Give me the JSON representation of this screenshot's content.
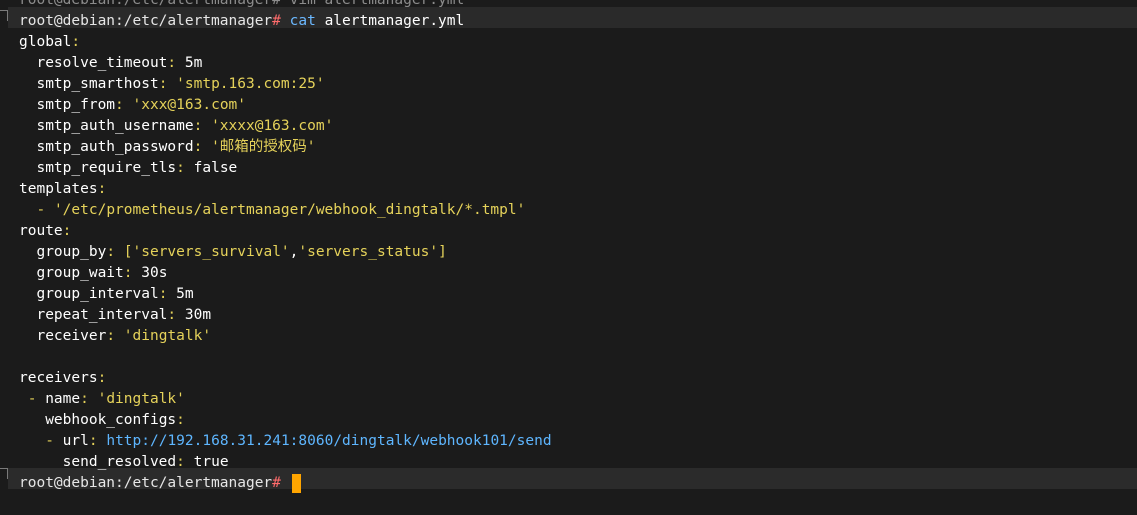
{
  "previous_command_line": "root@debian:/etc/alertmanager# vim alertmanager.yml",
  "prompt": {
    "user_host_path": "root@debian:/etc/alertmanager",
    "symbol": "#"
  },
  "command": {
    "name": "cat",
    "arg": " alertmanager.yml"
  },
  "yaml": {
    "global_key": "global",
    "resolve_timeout_key": "resolve_timeout",
    "resolve_timeout_val": "5m",
    "smtp_smarthost_key": "smtp_smarthost",
    "smtp_smarthost_val": "'smtp.163.com:25'",
    "smtp_from_key": "smtp_from",
    "smtp_from_val": "'xxx@163.com'",
    "smtp_auth_username_key": "smtp_auth_username",
    "smtp_auth_username_val": "'xxxx@163.com'",
    "smtp_auth_password_key": "smtp_auth_password",
    "smtp_auth_password_val": "'邮箱的授权码'",
    "smtp_require_tls_key": "smtp_require_tls",
    "smtp_require_tls_val": "false",
    "templates_key": "templates",
    "template_item": "'/etc/prometheus/alertmanager/webhook_dingtalk/*.tmpl'",
    "route_key": "route",
    "group_by_key": "group_by",
    "group_by_open": "[",
    "group_by_val1": "'servers_survival'",
    "group_by_comma": ",",
    "group_by_val2": "'servers_status'",
    "group_by_close": "]",
    "group_wait_key": "group_wait",
    "group_wait_val": "30s",
    "group_interval_key": "group_interval",
    "group_interval_val": "5m",
    "repeat_interval_key": "repeat_interval",
    "repeat_interval_val": "30m",
    "receiver_key": "receiver",
    "receiver_val": "'dingtalk'",
    "receivers_key": "receivers",
    "name_key": "name",
    "name_val": "'dingtalk'",
    "webhook_configs_key": "webhook_configs",
    "url_key": "url",
    "url_val": "http://192.168.31.241:8060/dingtalk/webhook101/send",
    "send_resolved_key": "send_resolved",
    "send_resolved_val": "true"
  },
  "colors": {
    "background": "#1b1b1b",
    "hash": "#ff6b6b",
    "command": "#6bb8ff",
    "string": "#e5d25a",
    "url": "#5eb6ff",
    "cursor": "#ffa500"
  }
}
